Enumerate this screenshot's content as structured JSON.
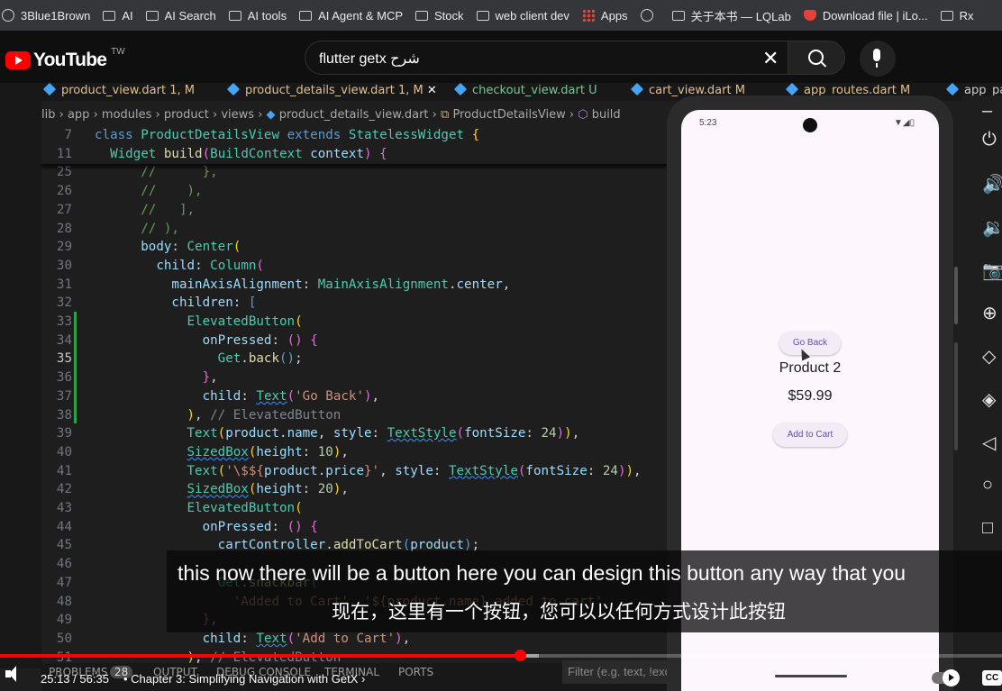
{
  "bookmarks": [
    {
      "label": "3Blue1Brown",
      "icon": "channel-icon"
    },
    {
      "label": "AI",
      "icon": "folder-icon"
    },
    {
      "label": "AI Search",
      "icon": "folder-icon"
    },
    {
      "label": "AI tools",
      "icon": "folder-icon"
    },
    {
      "label": "AI Agent & MCP",
      "icon": "folder-icon"
    },
    {
      "label": "Stock",
      "icon": "folder-icon"
    },
    {
      "label": "web client dev",
      "icon": "folder-icon"
    },
    {
      "label": "Apps",
      "icon": "apps-grid-icon"
    },
    {
      "label": "",
      "icon": "globe-icon"
    },
    {
      "label": "关于本书 — LQLab",
      "icon": "page-icon"
    },
    {
      "label": "Download file | iLo...",
      "icon": "heart-icon"
    },
    {
      "label": "Rx",
      "icon": "folder-icon"
    }
  ],
  "youtube": {
    "logo_text": "YouTube",
    "region": "TW",
    "search_value": "flutter getx شرح"
  },
  "editor": {
    "tabs": [
      {
        "name": "product_view.dart",
        "status": "1, M"
      },
      {
        "name": "product_details_view.dart",
        "status": "1, M"
      },
      {
        "name": "checkout_view.dart",
        "status": "U"
      },
      {
        "name": "cart_view.dart",
        "status": "M"
      },
      {
        "name": "app_routes.dart",
        "status": "M"
      },
      {
        "name": "app_pa",
        "status": ""
      }
    ],
    "breadcrumb": [
      "lib",
      "app",
      "modules",
      "product",
      "views",
      "product_details_view.dart",
      "ProductDetailsView",
      "build"
    ],
    "line_numbers": [
      "7",
      "11",
      "25",
      "26",
      "27",
      "28",
      "29",
      "30",
      "31",
      "32",
      "33",
      "34",
      "35",
      "36",
      "37",
      "38",
      "39",
      "40",
      "41",
      "42",
      "43",
      "44",
      "45",
      "46",
      "47",
      "48",
      "49",
      "50",
      "51"
    ],
    "panel_tabs": [
      "PROBLEMS",
      "28",
      "OUTPUT",
      "DEBUG CONSOLE",
      "TERMINAL",
      "PORTS"
    ],
    "filter_placeholder": "Filter (e.g. text, !exc"
  },
  "emulator": {
    "time": "5:23",
    "go_back_label": "Go Back",
    "product_name": "Product 2",
    "product_price": "$59.99",
    "add_to_cart_label": "Add to Cart"
  },
  "subtitles": {
    "english": "this now there will be a button here you can design this button any way that you",
    "chinese": "现在，这里有一个按钮，您可以以任何方式设计此按钮"
  },
  "player": {
    "current_time": "25:13",
    "duration": "56:35",
    "chapter": "Chapter 3: Simplifying Navigation with GetX",
    "progress_fraction": 0.446,
    "buffered_fraction": 0.46,
    "cc_label": "CC"
  },
  "colors": {
    "youtube_red": "#ff0000",
    "accent_purple": "#6750a4"
  }
}
